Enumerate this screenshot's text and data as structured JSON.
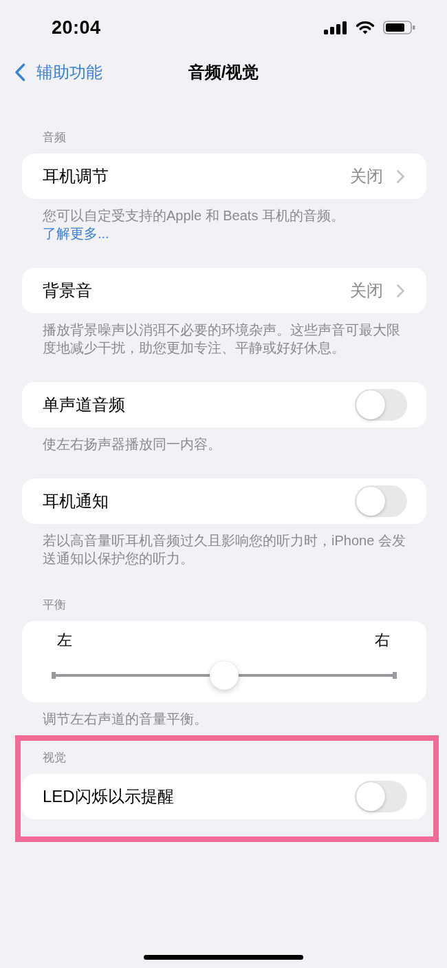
{
  "status_bar": {
    "time": "20:04"
  },
  "nav": {
    "back_label": "辅助功能",
    "title": "音频/视觉"
  },
  "groups": [
    {
      "header": "音频",
      "row": {
        "kind": "link",
        "label": "耳机调节",
        "value": "关闭"
      },
      "footer": "您可以自定受支持的Apple 和 Beats 耳机的音频。",
      "footer_link": "了解更多..."
    },
    {
      "row": {
        "kind": "link",
        "label": "背景音",
        "value": "关闭"
      },
      "footer": "播放背景噪声以消弭不必要的环境杂声。这些声音可最大限度地减少干扰，助您更加专注、平静或好好休息。"
    },
    {
      "row": {
        "kind": "toggle",
        "label": "单声道音频",
        "on": false
      },
      "footer": "使左右扬声器播放同一内容。"
    },
    {
      "row": {
        "kind": "toggle",
        "label": "耳机通知",
        "on": false
      },
      "footer": "若以高音量听耳机音频过久且影响您的听力时，iPhone 会发送通知以保护您的听力。"
    },
    {
      "header": "平衡",
      "row": {
        "kind": "slider",
        "left_label": "左",
        "right_label": "右",
        "level": 0.5
      },
      "footer": "调节左右声道的音量平衡。"
    },
    {
      "header": "视觉",
      "highlighted": true,
      "row": {
        "kind": "toggle",
        "label": "LED闪烁以示提醒",
        "on": false
      }
    }
  ]
}
